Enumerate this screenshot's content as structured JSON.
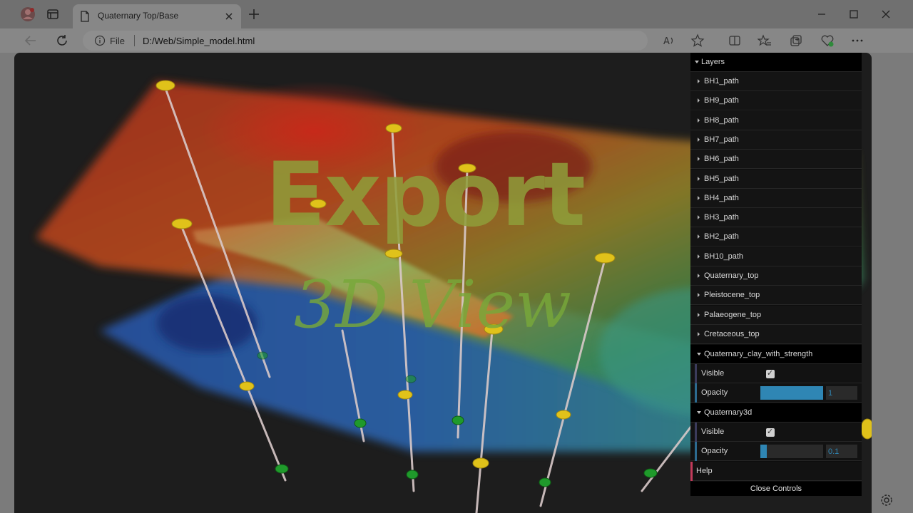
{
  "browser": {
    "tab_title": "Quaternary Top/Base",
    "address_file_label": "File",
    "url": "D:/Web/Simple_model.html"
  },
  "viewport": {
    "watermark_line1": "Export",
    "watermark_line2": "3D View",
    "colors": {
      "background": "#1d1d1d",
      "surface_high": "#c83a1e",
      "surface_mid": "#3f9a4a",
      "surface_low": "#2b6fd0",
      "borehole_cap": "#e0c21a",
      "borehole_marker": "#1f9a2b"
    }
  },
  "gui": {
    "layers_title": "Layers",
    "layers": [
      "BH1_path",
      "BH9_path",
      "BH8_path",
      "BH7_path",
      "BH6_path",
      "BH5_path",
      "BH4_path",
      "BH3_path",
      "BH2_path",
      "BH10_path",
      "Quaternary_top",
      "Pleistocene_top",
      "Palaeogene_top",
      "Cretaceous_top"
    ],
    "folders": [
      {
        "title": "Quaternary_clay_with_strength",
        "visible_label": "Visible",
        "visible": true,
        "opacity_label": "Opacity",
        "opacity": 1,
        "opacity_text": "1"
      },
      {
        "title": "Quaternary3d",
        "visible_label": "Visible",
        "visible": true,
        "opacity_label": "Opacity",
        "opacity": 0.1,
        "opacity_text": "0.1"
      }
    ],
    "help_label": "Help",
    "close_label": "Close Controls"
  }
}
